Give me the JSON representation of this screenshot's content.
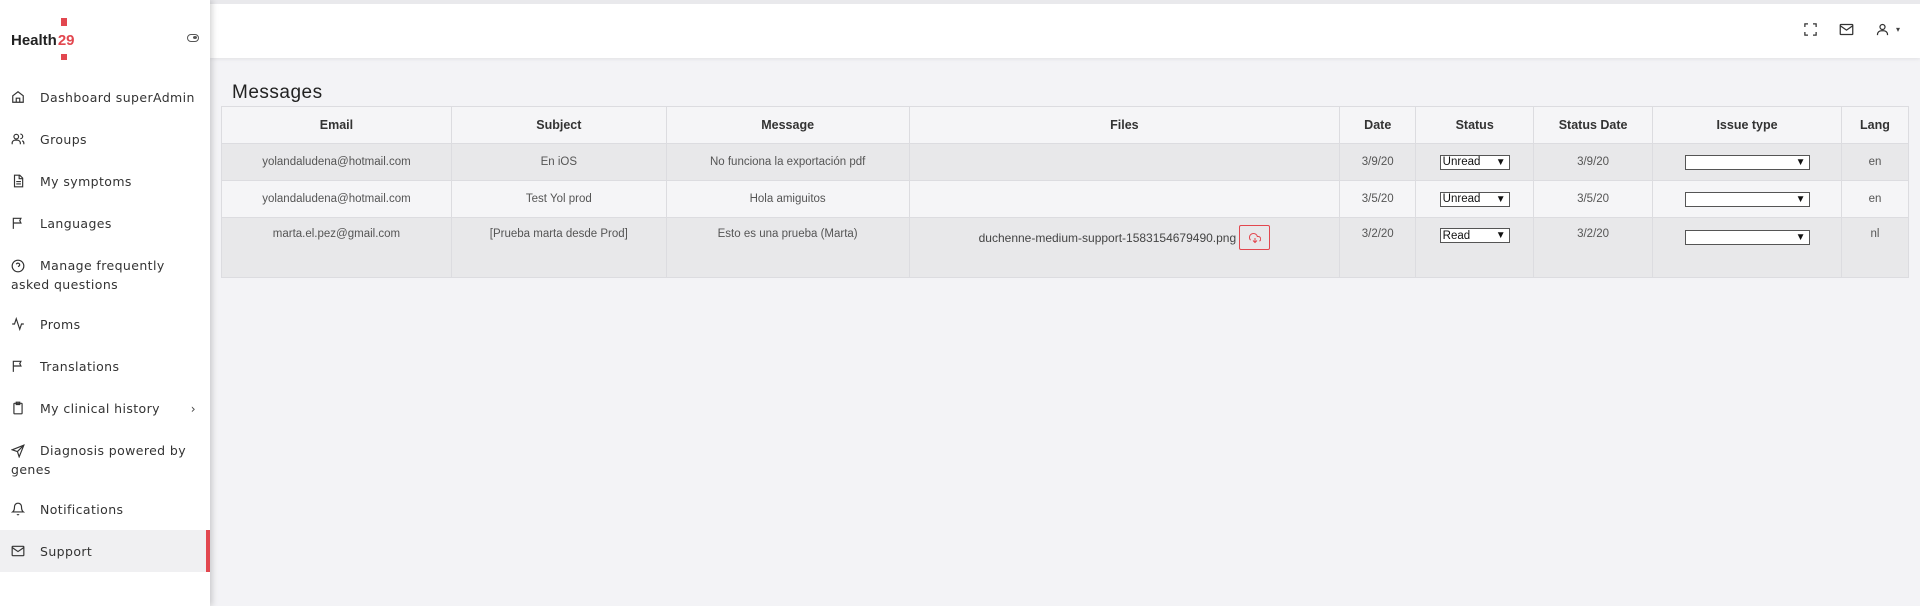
{
  "brand": {
    "name": "Health",
    "number": "29"
  },
  "sidebar": {
    "items": [
      {
        "label": "Dashboard superAdmin",
        "icon": "home-icon"
      },
      {
        "label": "Groups",
        "icon": "users-icon"
      },
      {
        "label": "My symptoms",
        "icon": "document-icon"
      },
      {
        "label": "Languages",
        "icon": "flag-icon"
      },
      {
        "label_line1": "Manage frequently",
        "label_line2": "asked questions",
        "icon": "help-circle-icon"
      },
      {
        "label": "Proms",
        "icon": "activity-icon"
      },
      {
        "label": "Translations",
        "icon": "flag-icon"
      },
      {
        "label": "My clinical history",
        "icon": "clipboard-icon",
        "chevron": "›"
      },
      {
        "label_line1": "Diagnosis powered by",
        "label_line2": "genes",
        "icon": "send-icon"
      },
      {
        "label": "Notifications",
        "icon": "bell-icon"
      },
      {
        "label": "Support",
        "icon": "mail-icon",
        "active": true
      }
    ]
  },
  "topbar": {
    "icons": [
      "fullscreen-icon",
      "mail-icon",
      "user-icon"
    ],
    "caret": "▾"
  },
  "main": {
    "title": "Messages",
    "columns": [
      "Email",
      "Subject",
      "Message",
      "Files",
      "Date",
      "Status",
      "Status Date",
      "Issue type",
      "Lang"
    ],
    "rows": [
      {
        "email": "yolandaludena@hotmail.com",
        "subject": "En iOS",
        "message": "No funciona la exportación pdf",
        "file": "",
        "date": "3/9/20",
        "status": "Unread",
        "status_date": "3/9/20",
        "issue_type": "",
        "lang": "en"
      },
      {
        "email": "yolandaludena@hotmail.com",
        "subject": "Test Yol prod",
        "message": "Hola amiguitos",
        "file": "",
        "date": "3/5/20",
        "status": "Unread",
        "status_date": "3/5/20",
        "issue_type": "",
        "lang": "en"
      },
      {
        "email": "marta.el.pez@gmail.com",
        "subject": "[Prueba marta desde Prod]",
        "message": "Esto es una prueba (Marta)",
        "file": "duchenne-medium-support-1583154679490.png",
        "date": "3/2/20",
        "status": "Read",
        "status_date": "3/2/20",
        "issue_type": "",
        "lang": "nl"
      }
    ],
    "select_arrow": "▼"
  },
  "colors": {
    "accent": "#e2474f",
    "background": "#f3f3f6",
    "row_shaded": "#e8e8ea"
  }
}
